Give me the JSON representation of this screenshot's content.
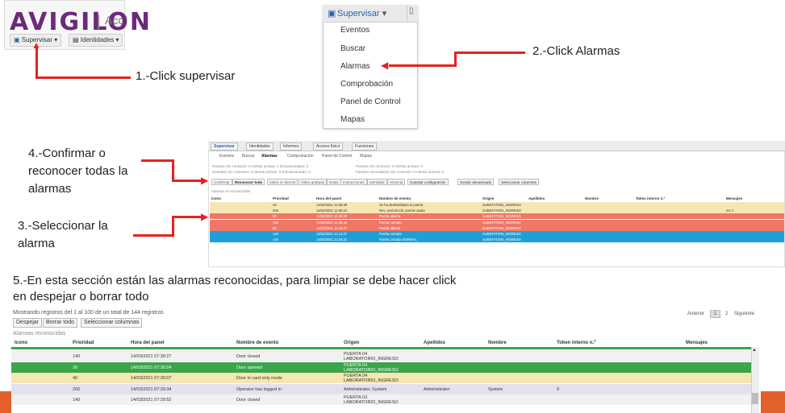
{
  "logo": {
    "brand": "AVIGILON",
    "sep": "|",
    "trail": "Acc",
    "menu1": "Supervisar",
    "menu2": "Identidades"
  },
  "dropdown": {
    "header": "Supervisar",
    "items": [
      "Eventos",
      "Buscar",
      "Alarmas",
      "Comprobación",
      "Panel de Control",
      "Mapas"
    ]
  },
  "annotations": {
    "step1": "1.-Click supervisar",
    "step2": "2.-Click Alarmas",
    "step4": "4.-Confirmar  o reconocer todas la alarmas",
    "step3": "3.-Seleccionar la alarma",
    "step5": "5.-En esta sección están las alarmas reconocidas, para limpiar se debe hacer click en despejar o borrar todo"
  },
  "main": {
    "nav": [
      "Supervisar",
      "Identidades",
      "Informes",
      "Acceso físico",
      "Funciones"
    ],
    "tabs": [
      "Eventos",
      "Buscar",
      "Alarmas",
      "Comprobación",
      "Panel de Control",
      "Mapas"
    ],
    "status1": "Puertas Sin conexión: 0 Alertas activas: 1 Enmascaradas: 0",
    "status1b": "Puertos Sin conexión: 0 Alertas activas: 0",
    "status2": "Entradas Sin conexión: 0 Alertas activas: 0 Enmascaradas: 0",
    "status2b": "Paneles secundarios Sin conexión: 0 Alertas activas: 0",
    "buttons": [
      "Confirmar",
      "Reconocer todo",
      "Video en directo",
      "Video grabado",
      "Notas",
      "Instrucciones",
      "Identidad",
      "Historial",
      "Guardar configuración",
      "Sonido desactivado",
      "Seleccionar columnas"
    ],
    "section": "Alarmas no reconocidas",
    "columns": [
      "Icono",
      "Prioridad",
      "Hora del panel",
      "Nombre de evento",
      "Origen",
      "Apellidos",
      "Nombre",
      "Token interno n.º",
      "Mensajes"
    ],
    "rows": [
      {
        "prio": "40",
        "time": "14/03/2021 11:56:39",
        "event": "Se ha deshabilitado la puerta",
        "origin": "SUBSTATION_INGRESO",
        "msg": "",
        "color": "#f6e6b4"
      },
      {
        "prio": "200",
        "time": "14/03/2021 11:50:24",
        "event": "Rev. envío/recib. puerta usada",
        "origin": "SUBSTATION_INGRESO",
        "msg": "rev 1",
        "color": "#f6e6b4"
      },
      {
        "prio": "50",
        "time": "14/03/2021 11:39:30",
        "event": "Puerta abierta",
        "origin": "SUBSTATION_INGRESO",
        "msg": "",
        "color": "#ef7768"
      },
      {
        "prio": "150",
        "time": "14/03/2021 11:38:49",
        "event": "Puerta cerrada",
        "origin": "SUBSTATION_INGRESO",
        "msg": "",
        "color": "#ef7768"
      },
      {
        "prio": "50",
        "time": "14/03/2021 11:24:27",
        "event": "Puerta abierta",
        "origin": "SUBSTATION_INGRESO",
        "msg": "",
        "color": "#ef7768"
      },
      {
        "prio": "140",
        "time": "14/03/2021 11:14:27",
        "event": "Puerta cerrada",
        "origin": "SUBSTATION_INGRESO",
        "msg": "",
        "color": "#1e9fd8"
      },
      {
        "prio": "140",
        "time": "14/03/2021 11:04:21",
        "event": "Puerta cerrada NORMAL",
        "origin": "SUBSTATION_INGRESO",
        "msg": "",
        "color": "#1e9fd8"
      }
    ]
  },
  "bottom": {
    "records": "Mostrando registros del 1 al 100 de un total de 144 registros",
    "btn_clear": "Despejar",
    "btn_clear_all": "Borrar todo",
    "btn_columns": "Seleccionar columnas",
    "section": "Alarmas reconocidas",
    "pager_prev": "Anterior",
    "pager_p1": "1",
    "pager_p2": "2",
    "pager_next": "Siguiente",
    "columns": [
      "Icono",
      "Prioridad",
      "Hora del panel",
      "Nombre de evento",
      "Origen",
      "Apellidos",
      "Nombre",
      "Token interno n.º",
      "Mensajes"
    ],
    "rows": [
      {
        "prio": "140",
        "time": "14/03/2021 07:30:27",
        "event": "Door closed",
        "origin1": "PUERTA 04",
        "origin2": "LABORATORIO_INGRESO",
        "last": "",
        "first": "",
        "token": "",
        "color": "#f1f1f1",
        "text": "#333"
      },
      {
        "prio": "20",
        "time": "14/03/2021 07:30:24",
        "event": "Door opened",
        "origin1": "PUERTA 04",
        "origin2": "LABORATORIO_INGRESO",
        "last": "",
        "first": "",
        "token": "",
        "color": "#3aa54a",
        "text": "#ffffff"
      },
      {
        "prio": "40",
        "time": "14/03/2021 07:30:07",
        "event": "Door in card only mode",
        "origin1": "PUERTA 04",
        "origin2": "LABORATORIO_INGRESO",
        "last": "",
        "first": "",
        "token": "",
        "color": "#f6e6b4",
        "text": "#333"
      },
      {
        "prio": "200",
        "time": "14/03/2021 07:29:34",
        "event": "Operator has logged in",
        "origin1": "Administrator, System",
        "origin2": "",
        "last": "Administrator",
        "first": "System",
        "token": "0",
        "color": "#e2e2ef",
        "text": "#333"
      },
      {
        "prio": "140",
        "time": "14/03/2021 07:29:52",
        "event": "Door closed",
        "origin1": "PUERTA 03",
        "origin2": "LABORATORIO_INGRESO",
        "last": "",
        "first": "",
        "token": "",
        "color": "#f1f1f1",
        "text": "#333"
      }
    ]
  }
}
